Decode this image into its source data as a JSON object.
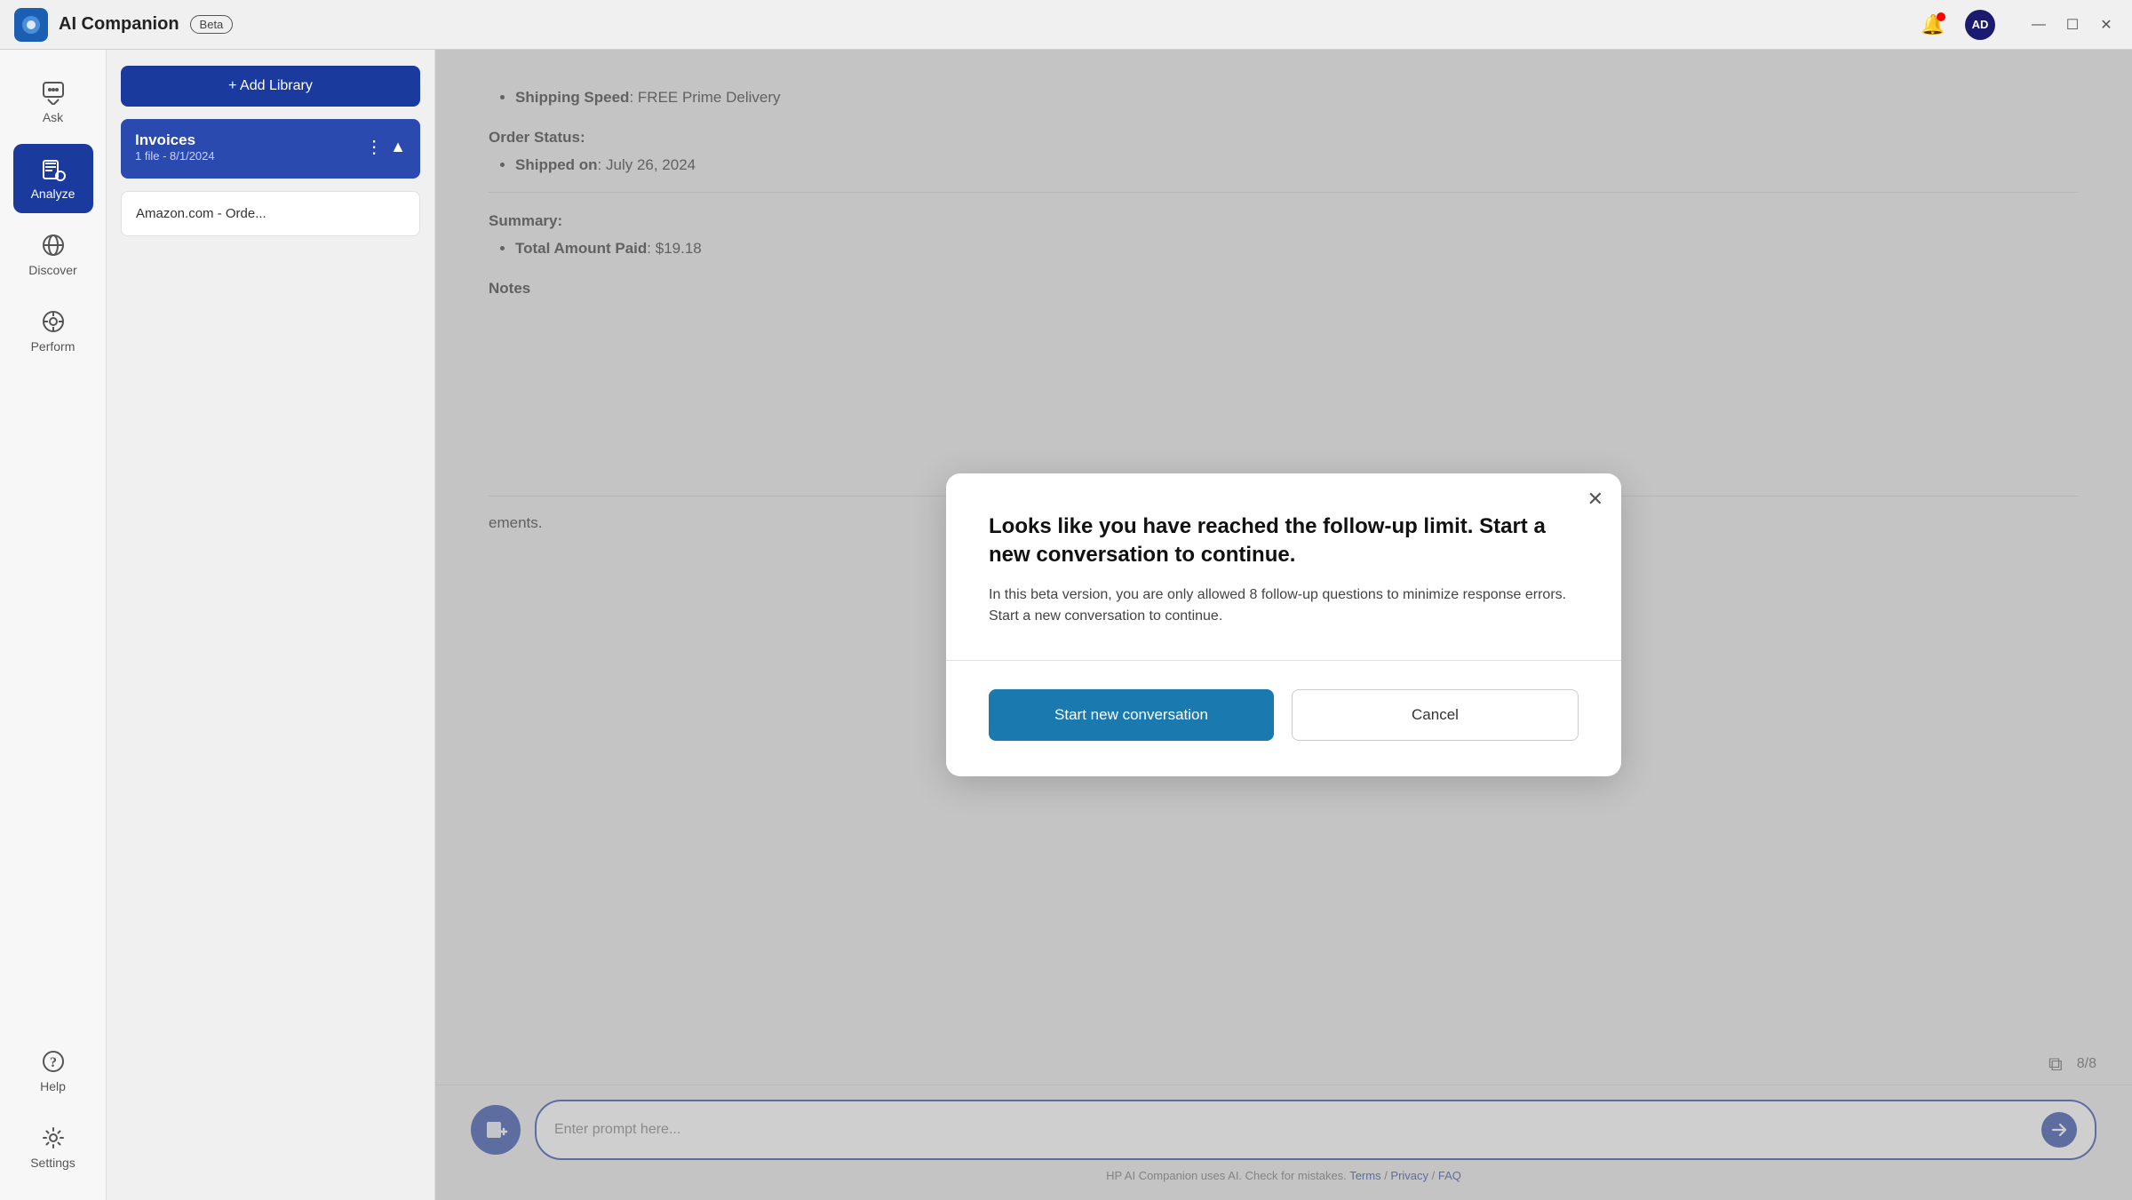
{
  "titleBar": {
    "appTitle": "AI Companion",
    "betaLabel": "Beta",
    "userName": "AD",
    "windowControls": {
      "minimize": "—",
      "maximize": "☐",
      "close": "✕"
    }
  },
  "sidebar": {
    "items": [
      {
        "id": "ask",
        "label": "Ask",
        "active": false
      },
      {
        "id": "analyze",
        "label": "Analyze",
        "active": true
      },
      {
        "id": "discover",
        "label": "Discover",
        "active": false
      },
      {
        "id": "perform",
        "label": "Perform",
        "active": false
      },
      {
        "id": "help",
        "label": "Help",
        "active": false
      },
      {
        "id": "settings",
        "label": "Settings",
        "active": false
      }
    ]
  },
  "library": {
    "addButtonLabel": "+ Add Library",
    "libraryItem": {
      "title": "Invoices",
      "subtitle": "1 file - 8/1/2024"
    },
    "documents": [
      {
        "name": "Amazon.com - Orde..."
      }
    ]
  },
  "docContent": {
    "shippingLabel": "Shipping Speed",
    "shippingValue": "FREE Prime Delivery",
    "orderStatusLabel": "Order Status:",
    "shippedOnLabel": "Shipped on",
    "shippedOnValue": "July 26, 2024",
    "summaryLabel": "Summary:",
    "totalLabel": "Total Amount Paid",
    "totalValue": "$19.18",
    "notesLabel": "Notes",
    "partialText": "ements.",
    "messageCount": "8/8"
  },
  "inputBar": {
    "placeholder": "Enter prompt here...",
    "footerText": "HP AI Companion uses AI. Check for mistakes.",
    "termsLabel": "Terms",
    "privacyLabel": "Privacy",
    "faqLabel": "FAQ"
  },
  "modal": {
    "title": "Looks like you have reached the follow-up limit. Start a new conversation to continue.",
    "body": "In this beta version, you are only allowed 8 follow-up questions to minimize response errors. Start a new conversation to continue.",
    "primaryButton": "Start new conversation",
    "cancelButton": "Cancel"
  }
}
